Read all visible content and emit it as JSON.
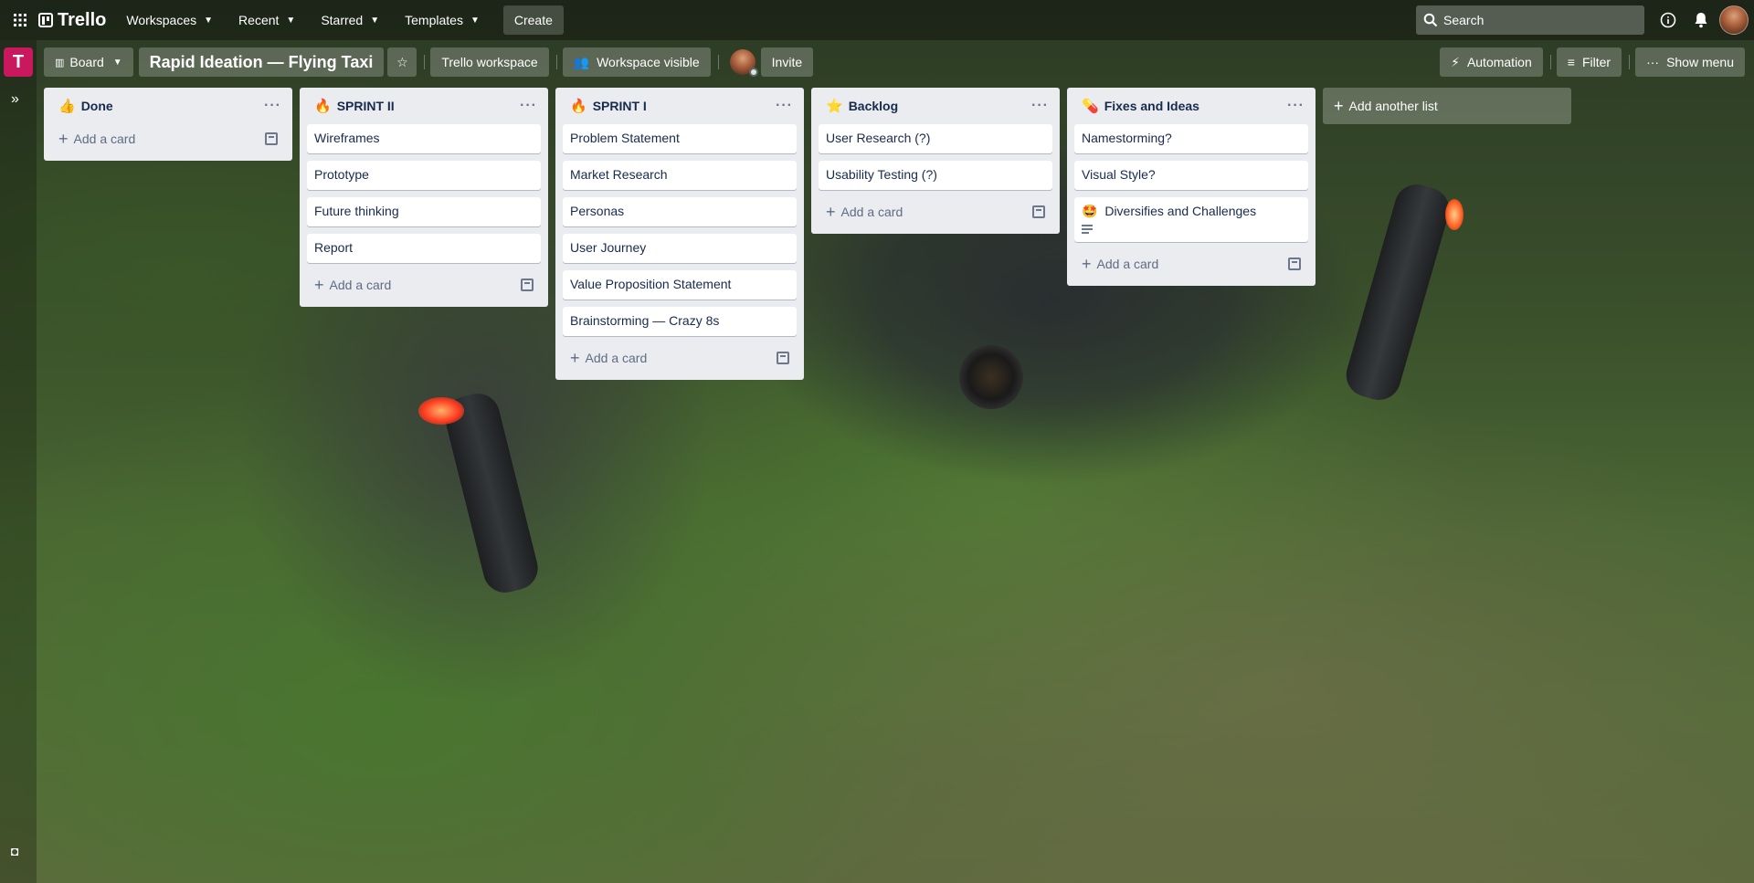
{
  "header": {
    "logo": "Trello",
    "nav": [
      {
        "label": "Workspaces"
      },
      {
        "label": "Recent"
      },
      {
        "label": "Starred"
      },
      {
        "label": "Templates"
      }
    ],
    "create_label": "Create",
    "search_placeholder": "Search"
  },
  "board_header": {
    "workspace_initial": "T",
    "view_label": "Board",
    "title": "Rapid Ideation — Flying Taxi",
    "workspace_label": "Trello workspace",
    "visibility_label": "Workspace visible",
    "invite_label": "Invite",
    "automation_label": "Automation",
    "filter_label": "Filter",
    "show_menu_label": "Show menu"
  },
  "lists": [
    {
      "emoji": "👍",
      "title": "Done",
      "cards": [],
      "add_label": "Add a card"
    },
    {
      "emoji": "🔥",
      "title": "SPRINT II",
      "cards": [
        "Wireframes",
        "Prototype",
        "Future thinking",
        "Report"
      ],
      "add_label": "Add a card"
    },
    {
      "emoji": "🔥",
      "title": "SPRINT I",
      "cards": [
        "Problem Statement",
        "Market Research",
        "Personas",
        "User Journey",
        "Value Proposition Statement",
        "Brainstorming — Crazy 8s"
      ],
      "add_label": "Add a card"
    },
    {
      "emoji": "⭐",
      "title": "Backlog",
      "cards": [
        "User Research (?)",
        "Usability Testing (?)"
      ],
      "add_label": "Add a card"
    },
    {
      "emoji": "💊",
      "title": "Fixes and Ideas",
      "cards": [
        "Namestorming?",
        "Visual Style?",
        "Diversifies and Challenges"
      ],
      "card_emoji": "🤩",
      "add_label": "Add a card"
    }
  ],
  "add_list_label": "Add another list",
  "colors": {
    "workspace_badge": "#c9185e",
    "list_bg": "#ebecf0",
    "card_bg": "#ffffff"
  }
}
